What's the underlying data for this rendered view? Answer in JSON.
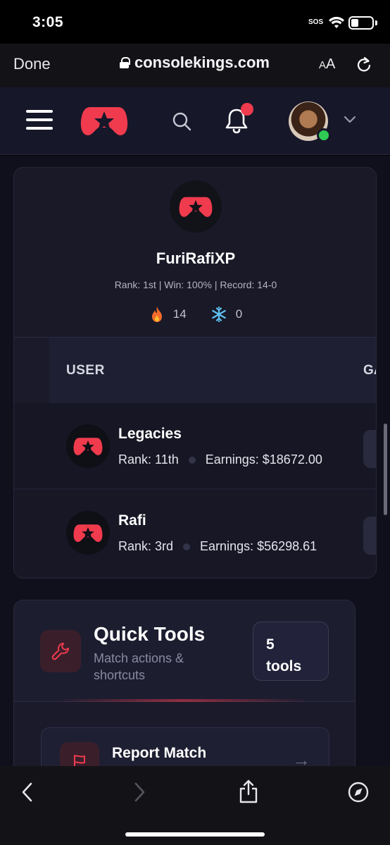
{
  "status_bar": {
    "time": "3:05",
    "sos": "SOS"
  },
  "browser": {
    "done_label": "Done",
    "url": "consolekings.com",
    "text_size_small": "A",
    "text_size_large": "A"
  },
  "header": {
    "has_notification": true
  },
  "profile": {
    "name": "FuriRafiXP",
    "stats": "Rank: 1st | Win: 100% | Record: 14-0",
    "win_streak": "14",
    "cold_streak": "0"
  },
  "table": {
    "columns": [
      "USER",
      "GA"
    ],
    "rows": [
      {
        "name": "Legacies",
        "rank": "Rank: 11th",
        "earnings": "Earnings: $18672.00"
      },
      {
        "name": "Rafi",
        "rank": "Rank: 3rd",
        "earnings": "Earnings: $56298.61"
      }
    ]
  },
  "quick_tools": {
    "title": "Quick Tools",
    "subtitle": "Match actions & shortcuts",
    "badge_count": "5",
    "badge_unit": "tools",
    "items": [
      {
        "label": "Report Match"
      }
    ]
  },
  "colors": {
    "brand": "#ef3b4d",
    "online": "#2ecc54",
    "background": "#10101c"
  }
}
